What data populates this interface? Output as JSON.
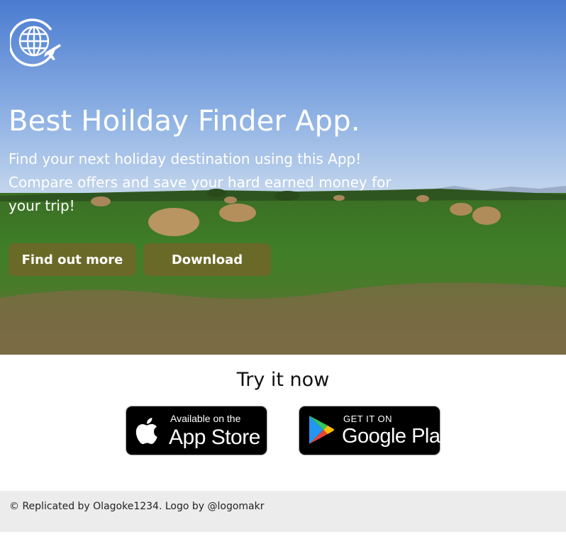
{
  "hero": {
    "title": "Best Hoilday Finder App.",
    "description": "Find your next holiday destination using this App! Compare offers and save your hard earned money for your trip!",
    "buttons": {
      "find_out_more": "Find out more",
      "download": "Download"
    },
    "logo_icon": "globe-airplane-icon",
    "button_color": "#8c5a28"
  },
  "try_section": {
    "heading": "Try it now",
    "app_store": {
      "small": "Available on the",
      "big": "App Store",
      "icon": "apple-icon"
    },
    "google_play": {
      "small": "GET IT ON",
      "big": "Google Play",
      "icon": "google-play-icon"
    }
  },
  "footer": {
    "text": "© Replicated by Olagoke1234. Logo by @logomakr"
  }
}
